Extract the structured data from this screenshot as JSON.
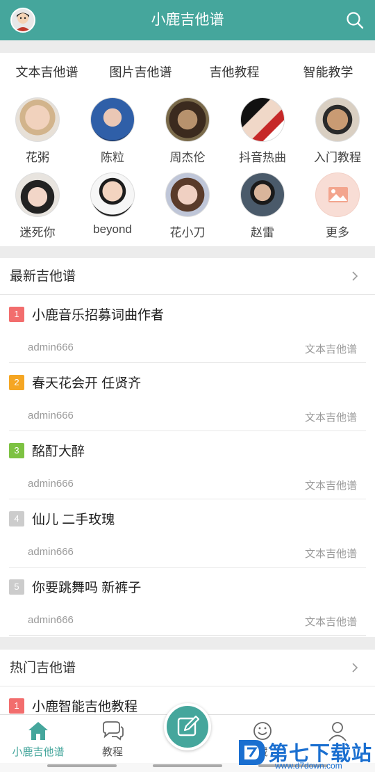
{
  "header": {
    "title": "小鹿吉他谱"
  },
  "categories": [
    "文本吉他谱",
    "图片吉他谱",
    "吉他教程",
    "智能教学"
  ],
  "artists": [
    {
      "name": "花粥"
    },
    {
      "name": "陈粒"
    },
    {
      "name": "周杰伦"
    },
    {
      "name": "抖音热曲"
    },
    {
      "name": "入门教程"
    },
    {
      "name": "迷死你"
    },
    {
      "name": "beyond"
    },
    {
      "name": "花小刀"
    },
    {
      "name": "赵雷"
    },
    {
      "name": "更多"
    }
  ],
  "latest": {
    "title": "最新吉他谱",
    "items": [
      {
        "rank": "1",
        "song": "小鹿音乐招募词曲作者",
        "user": "admin666",
        "type": "文本吉他谱",
        "badge_color": "#f26d6d"
      },
      {
        "rank": "2",
        "song": "春天花会开 任贤齐",
        "user": "admin666",
        "type": "文本吉他谱",
        "badge_color": "#f5a623"
      },
      {
        "rank": "3",
        "song": "酩酊大醉",
        "user": "admin666",
        "type": "文本吉他谱",
        "badge_color": "#7dc242"
      },
      {
        "rank": "4",
        "song": "仙儿 二手玫瑰",
        "user": "admin666",
        "type": "文本吉他谱",
        "badge_color": "#cccccc"
      },
      {
        "rank": "5",
        "song": "你要跳舞吗 新裤子",
        "user": "admin666",
        "type": "文本吉他谱",
        "badge_color": "#cccccc"
      }
    ]
  },
  "hot": {
    "title": "热门吉他谱",
    "items": [
      {
        "rank": "1",
        "song": "小鹿智能吉他教程",
        "badge_color": "#f26d6d"
      }
    ]
  },
  "tabs": [
    {
      "label": "小鹿吉他谱",
      "active": true
    },
    {
      "label": "教程",
      "active": false
    },
    {
      "label": "藏",
      "active": false
    },
    {
      "label": "",
      "active": false
    }
  ],
  "colors": {
    "accent": "#45a69c",
    "watermark": "#1a6fd0"
  },
  "watermark": {
    "brand": "第七下载站",
    "url": "www.d7down.com"
  }
}
